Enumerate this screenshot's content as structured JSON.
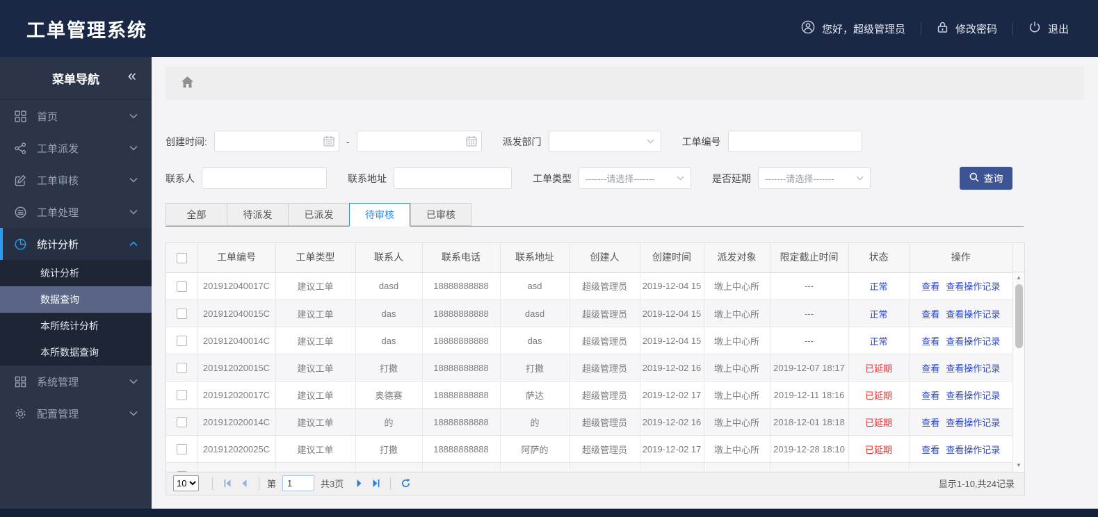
{
  "app": {
    "title": "工单管理系统"
  },
  "topbar": {
    "greeting": "您好，超级管理员",
    "change_password": "修改密码",
    "logout": "退出"
  },
  "sidebar": {
    "title": "菜单导航",
    "items": [
      {
        "label": "首页",
        "icon": "grid-icon"
      },
      {
        "label": "工单派发",
        "icon": "share-icon"
      },
      {
        "label": "工单审核",
        "icon": "edit-icon"
      },
      {
        "label": "工单处理",
        "icon": "layers-icon"
      },
      {
        "label": "统计分析",
        "icon": "pie-chart-icon",
        "expanded": true,
        "children": [
          {
            "label": "统计分析",
            "selected": false
          },
          {
            "label": "数据查询",
            "selected": true
          },
          {
            "label": "本所统计分析",
            "selected": false
          },
          {
            "label": "本所数据查询",
            "selected": false
          }
        ]
      },
      {
        "label": "系统管理",
        "icon": "apps-icon"
      },
      {
        "label": "配置管理",
        "icon": "gear-icon"
      }
    ]
  },
  "filters": {
    "create_time_label": "创建时间:",
    "range_separator": "-",
    "dispatch_dept_label": "派发部门",
    "order_no_label": "工单编号",
    "contact_label": "联系人",
    "address_label": "联系地址",
    "order_type_label": "工单类型",
    "order_type_value": "-------请选择-------",
    "delay_label": "是否延期",
    "delay_value": "-------请选择-------",
    "search_button": "查询"
  },
  "tabs": [
    {
      "label": "全部",
      "active": false
    },
    {
      "label": "待派发",
      "active": false
    },
    {
      "label": "已派发",
      "active": false
    },
    {
      "label": "待审核",
      "active": true
    },
    {
      "label": "已审核",
      "active": false
    }
  ],
  "table": {
    "columns": [
      "",
      "工单编号",
      "工单类型",
      "联系人",
      "联系电话",
      "联系地址",
      "创建人",
      "创建时间",
      "派发对象",
      "限定截止时间",
      "状态",
      "操作"
    ],
    "action_labels": [
      "查看",
      "查看操作记录"
    ],
    "rows": [
      {
        "id": "201912040017C",
        "type": "建议工单",
        "contact": "dasd",
        "phone": "18888888888",
        "address": "asd",
        "creator": "超级管理员",
        "created": "2019-12-04 15",
        "target": "墩上中心所",
        "deadline": "---",
        "status": "正常",
        "status_type": "normal"
      },
      {
        "id": "201912040015C",
        "type": "建议工单",
        "contact": "das",
        "phone": "18888888888",
        "address": "dasd",
        "creator": "超级管理员",
        "created": "2019-12-04 15",
        "target": "墩上中心所",
        "deadline": "---",
        "status": "正常",
        "status_type": "normal"
      },
      {
        "id": "201912040014C",
        "type": "建议工单",
        "contact": "das",
        "phone": "18888888888",
        "address": "das",
        "creator": "超级管理员",
        "created": "2019-12-04 15",
        "target": "墩上中心所",
        "deadline": "---",
        "status": "正常",
        "status_type": "normal"
      },
      {
        "id": "201912020015C",
        "type": "建议工单",
        "contact": "打撒",
        "phone": "18888888888",
        "address": "打撒",
        "creator": "超级管理员",
        "created": "2019-12-02 16",
        "target": "墩上中心所",
        "deadline": "2019-12-07 18:17",
        "status": "已延期",
        "status_type": "delayed"
      },
      {
        "id": "201912020017C",
        "type": "建议工单",
        "contact": "奥德赛",
        "phone": "18888888888",
        "address": "萨达",
        "creator": "超级管理员",
        "created": "2019-12-02 17",
        "target": "墩上中心所",
        "deadline": "2019-12-11 18:16",
        "status": "已延期",
        "status_type": "delayed"
      },
      {
        "id": "201912020014C",
        "type": "建议工单",
        "contact": "的",
        "phone": "18888888888",
        "address": "的",
        "creator": "超级管理员",
        "created": "2019-12-02 16",
        "target": "墩上中心所",
        "deadline": "2018-12-01 18:18",
        "status": "已延期",
        "status_type": "delayed"
      },
      {
        "id": "201912020025C",
        "type": "建议工单",
        "contact": "打撒",
        "phone": "18888888888",
        "address": "阿萨的",
        "creator": "超级管理员",
        "created": "2019-12-02 17",
        "target": "墩上中心所",
        "deadline": "2019-12-28 18:10",
        "status": "已延期",
        "status_type": "delayed"
      }
    ]
  },
  "pagination": {
    "page_size": "10",
    "page_prefix": "第",
    "page_value": "1",
    "total_pages": "共3页",
    "summary": "显示1-10,共24记录"
  },
  "colors": {
    "topbar_bg": "#1a2745",
    "accent_blue": "#2d8cf0",
    "search_button_bg": "#3d5494",
    "status_normal": "#2b46c8",
    "status_delayed": "#ee2c2c"
  }
}
